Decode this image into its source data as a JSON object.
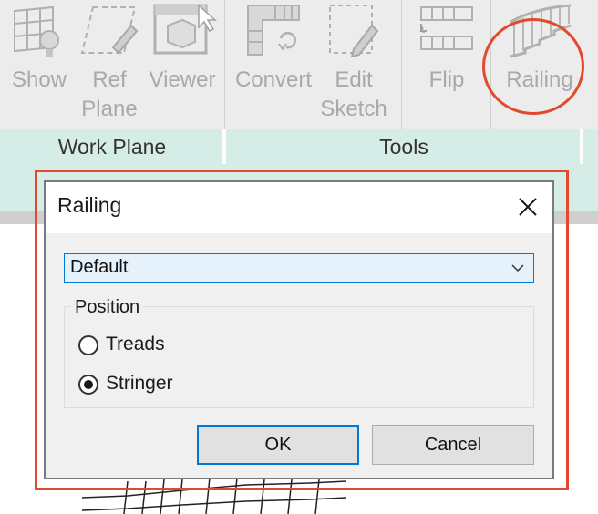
{
  "ribbon": {
    "buttons": [
      {
        "line1": "Show",
        "line2": "",
        "icon": "show-workplane-icon"
      },
      {
        "line1": "Ref",
        "line2": "Plane",
        "icon": "ref-plane-icon"
      },
      {
        "line1": "Viewer",
        "line2": "",
        "icon": "viewer-icon"
      },
      {
        "line1": "Convert",
        "line2": "",
        "icon": "convert-icon"
      },
      {
        "line1": "Edit",
        "line2": "Sketch",
        "icon": "edit-sketch-icon"
      },
      {
        "line1": "Flip",
        "line2": "",
        "icon": "flip-icon"
      },
      {
        "line1": "Railing",
        "line2": "",
        "icon": "railing-icon"
      }
    ],
    "panels": [
      {
        "title": "Work Plane"
      },
      {
        "title": "Tools"
      }
    ]
  },
  "dialog": {
    "title": "Railing",
    "railing_type": {
      "value": "Default"
    },
    "position": {
      "legend": "Position",
      "options": [
        {
          "label": "Treads",
          "selected": false
        },
        {
          "label": "Stringer",
          "selected": true
        }
      ]
    },
    "ok_label": "OK",
    "cancel_label": "Cancel"
  },
  "colors": {
    "highlight": "#e04a2e",
    "accent": "#0078d7",
    "panel_bar": "#d5ece7"
  }
}
